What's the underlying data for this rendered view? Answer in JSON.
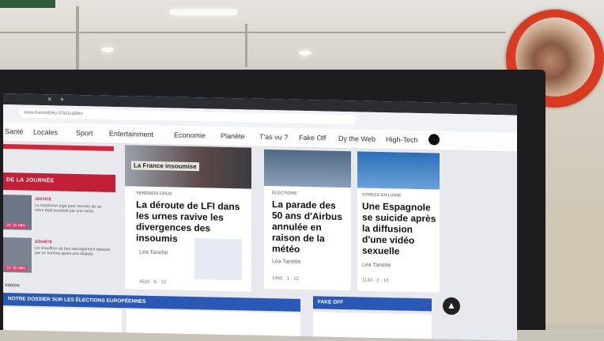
{
  "url": "www.francebleu.fr/actualites",
  "nav": [
    "Santé",
    "Locales",
    "Sport",
    "Entertainment",
    "Economie",
    "Planète",
    "T'as vu ?",
    "Fake Off",
    "Dy the Web",
    "High-Tech"
  ],
  "left_section": {
    "header": "DE LA JOURNÉE",
    "items": [
      {
        "tag": "JUSTICE",
        "text": "Le maraîcher jugé pour meurtre de sa mère était possédé par une secte",
        "badge": "2H 15 MIN"
      },
      {
        "tag": "SOCIÉTÉ",
        "text": "Un chauffeur de bus sauvagement tabassé par un homme après une dispute",
        "badge": "2H 30 MIN"
      }
    ],
    "footer": "VIDÉOS"
  },
  "cards": [
    {
      "img_label": "La France insoumise",
      "tag": "VENDREDI CRUS",
      "title": "La déroute de LFI dans les urnes ravive les divergences des insoumis",
      "author": "Léa Tanette",
      "stats": "4534  ·  5  ·  13"
    },
    {
      "tag": "ÉLECTIONS",
      "title": "La parade des 50 ans d'Airbus annulée en raison de la météo",
      "author": "Léa Tanette",
      "stats": "1460  ·  1  ·  22"
    },
    {
      "tag": "STRESS EN LIGNE",
      "title": "Une Espagnole se suicide après la diffusion d'une vidéo sexuelle",
      "author": "Léa Tanette",
      "stats": "1130  ·  2  ·  14"
    }
  ],
  "bottom": {
    "left_bar": "NOTRE DOSSIER SUR LES ÉLECTIONS EUROPÉENNES",
    "right_bar": "FAKE OFF"
  },
  "colors": {
    "accent": "#c21f39",
    "blue": "#2a58b6",
    "mirror": "#d83a22"
  }
}
